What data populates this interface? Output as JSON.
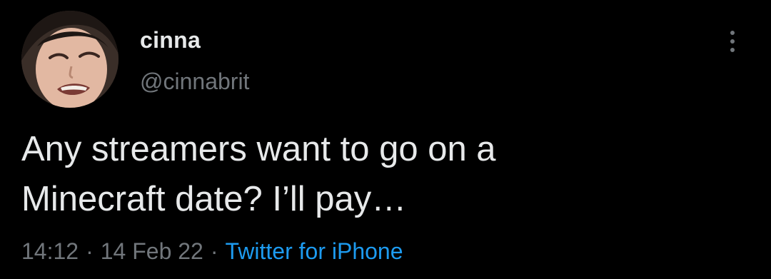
{
  "user": {
    "display_name": "cinna",
    "handle": "@cinnabrit",
    "avatar_icon": "profile-avatar"
  },
  "tweet": {
    "text": "Any streamers want to go on a\nMinecraft date? I’ll pay…",
    "time": "14:12",
    "date": "14 Feb 22",
    "separator": "·",
    "source": "Twitter for iPhone"
  },
  "more_icon": "more-options-icon",
  "colors": {
    "background": "#000000",
    "primary_text": "#e7e9ea",
    "secondary_text": "#71767b",
    "link": "#1d9bf0"
  }
}
